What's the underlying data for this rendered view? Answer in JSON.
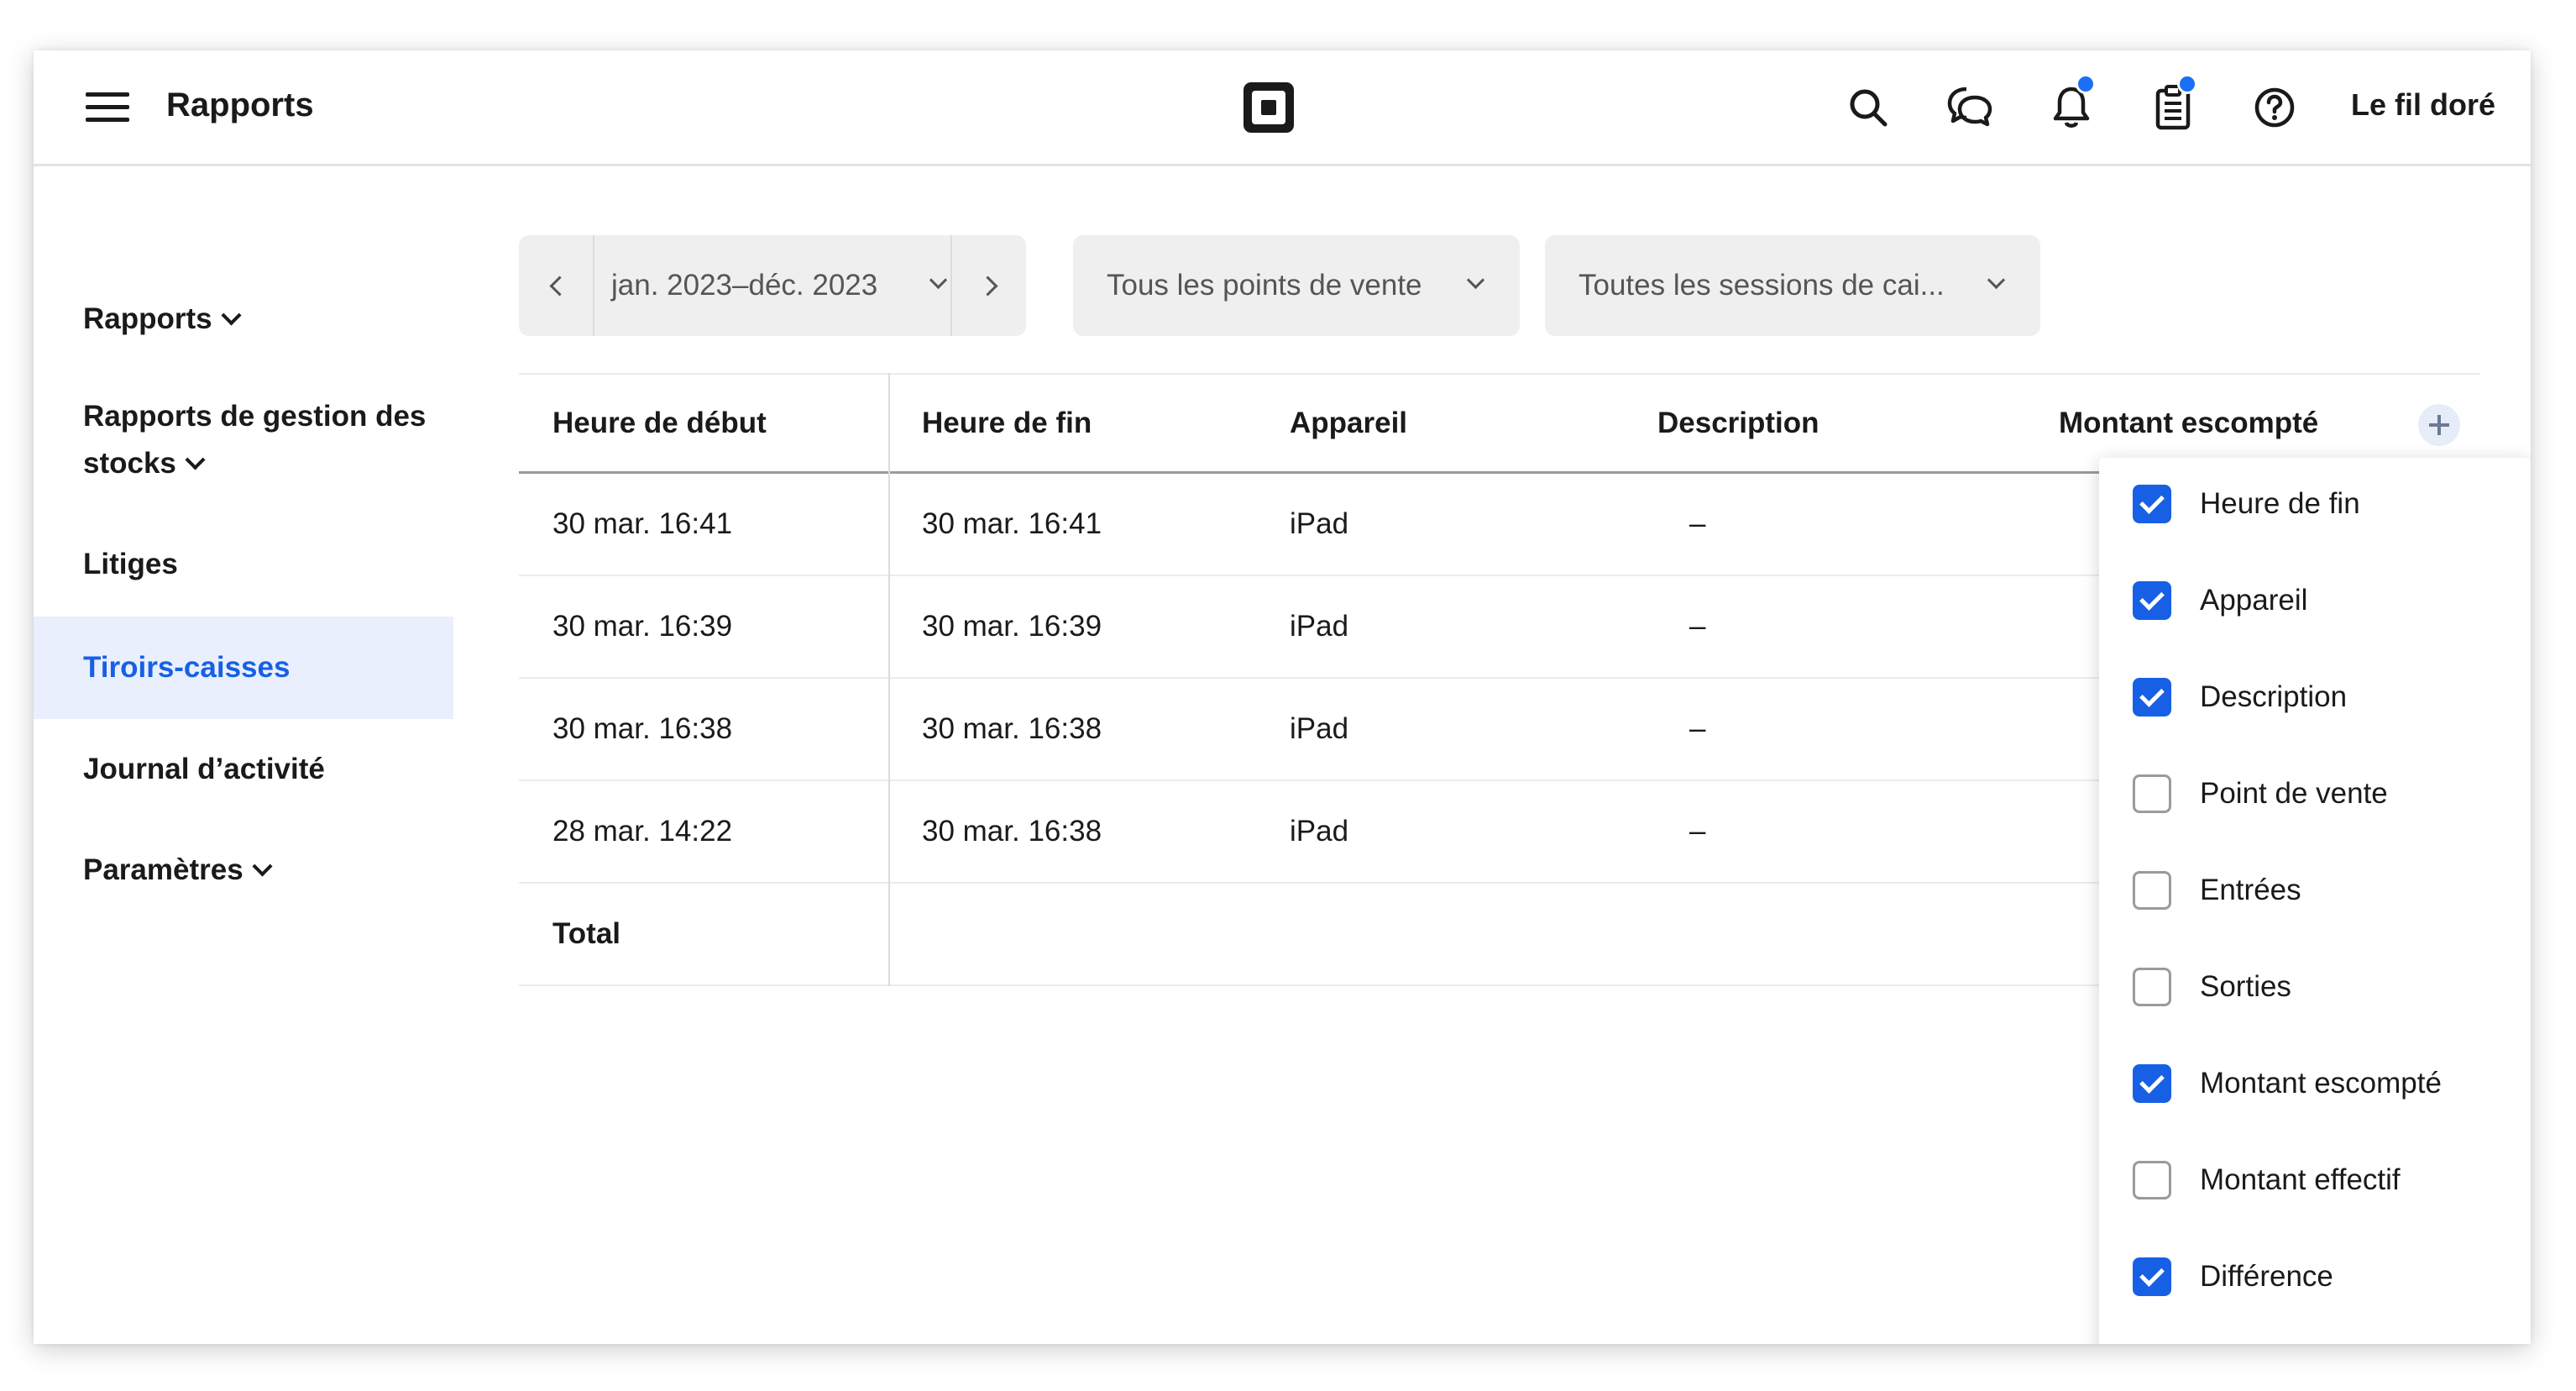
{
  "header": {
    "title": "Rapports",
    "business_name": "Le fil doré",
    "icons": [
      "menu-icon",
      "square-logo",
      "search-icon",
      "messages-icon",
      "bell-icon",
      "clipboard-icon",
      "help-icon"
    ],
    "accent_color": "#1b6ff5"
  },
  "sidebar": {
    "items": [
      {
        "label": "Rapports",
        "expandable": true,
        "active": false
      },
      {
        "label": "Rapports de gestion des",
        "label_line2": "stocks",
        "expandable": true,
        "active": false
      },
      {
        "label": "Litiges",
        "expandable": false,
        "active": false
      },
      {
        "label": "Tiroirs-caisses",
        "expandable": false,
        "active": true
      },
      {
        "label": "Journal d’activité",
        "expandable": false,
        "active": false
      },
      {
        "label": "Paramètres",
        "expandable": true,
        "active": false
      }
    ],
    "active_color": "#1760e5"
  },
  "filters": {
    "date_range": "jan. 2023–déc. 2023",
    "location": "Tous les points de vente",
    "sessions": "Toutes les sessions de cai..."
  },
  "table": {
    "columns": [
      "Heure de début",
      "Heure de fin",
      "Appareil",
      "Description",
      "Montant escompté"
    ],
    "rows": [
      [
        "30 mar. 16:41",
        "30 mar. 16:41",
        "iPad",
        "–"
      ],
      [
        "30 mar. 16:39",
        "30 mar. 16:39",
        "iPad",
        "–"
      ],
      [
        "30 mar. 16:38",
        "30 mar. 16:38",
        "iPad",
        "–"
      ],
      [
        "28 mar. 14:22",
        "30 mar. 16:38",
        "iPad",
        "–"
      ]
    ],
    "total_label": "Total"
  },
  "column_menu": {
    "options": [
      {
        "label": "Heure de fin",
        "checked": true
      },
      {
        "label": "Appareil",
        "checked": true
      },
      {
        "label": "Description",
        "checked": true
      },
      {
        "label": "Point de vente",
        "checked": false
      },
      {
        "label": "Entrées",
        "checked": false
      },
      {
        "label": "Sorties",
        "checked": false
      },
      {
        "label": "Montant escompté",
        "checked": true
      },
      {
        "label": "Montant effectif",
        "checked": false
      },
      {
        "label": "Différence",
        "checked": true
      }
    ]
  }
}
